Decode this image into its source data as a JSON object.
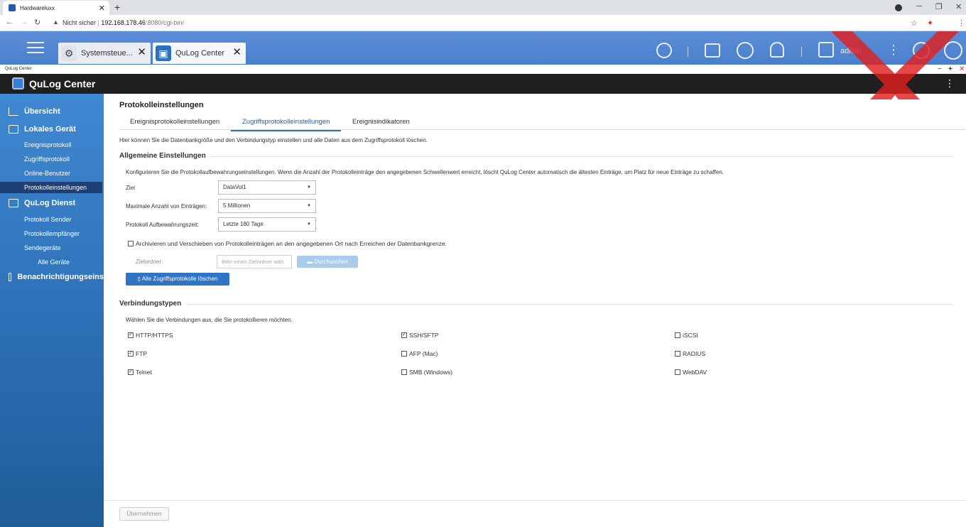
{
  "browser": {
    "tab_title": "Hardwareluxx",
    "tab_close": "✕",
    "new_tab": "+",
    "security": "Nicht sicher",
    "url_host": "192.168.178.46",
    "url_path": ":8080/cgi-bin/",
    "win_min": "─",
    "win_max": "❐",
    "win_close": "✕"
  },
  "qts": {
    "tabs": [
      {
        "label": "Systemsteue..."
      },
      {
        "label": "QuLog Center"
      }
    ],
    "user": "admin"
  },
  "app": {
    "window_label": "QuLog Center",
    "title": "QuLog Center"
  },
  "sidebar": {
    "overview": "Übersicht",
    "local": "Lokales Gerät",
    "local_items": [
      "Ereignisprotokoll",
      "Zugriffsprotokoll",
      "Online-Benutzer",
      "Protokolleinstellungen"
    ],
    "service": "QuLog Dienst",
    "service_items": [
      "Protokoll Sender",
      "Protokollempfänger",
      "Sendegeräte"
    ],
    "all_devices": "Alle Geräte",
    "notify": "Benachrichtigungseins"
  },
  "main": {
    "heading": "Protokolleinstellungen",
    "tabs": [
      "Ereignisprotokolleinstellungen",
      "Zugriffsprotokolleinstellungen",
      "Ereignisindikatoren"
    ],
    "description": "Hier können Sie die Datenbankgröße und den Verbindungstyp einstellen und alle Daten aus dem Zugriffsprotokoll löschen.",
    "general_title": "Allgemeine Einstellungen",
    "general_desc": "Konfigurieren Sie die Protokollaufbewahrungseinstellungen. Wenn die Anzahl der Protokolleinträge den angegebenen Schwellenwert erreicht, löscht QuLog Center automatisch die ältesten Einträge, um Platz für neue Einträge zu schaffen.",
    "fields": [
      {
        "label": "Ziel",
        "value": "DataVol1"
      },
      {
        "label": "Maximale Anzahl von Einträgen:",
        "value": "5 Millionen"
      },
      {
        "label": "Protokoll Aufbewahrungszeit:",
        "value": "Letzte 180 Tage"
      }
    ],
    "archive_label": "Archivieren und Verschieben von Protokolleinträgen an den angegebenen Ort nach Erreichen der Datenbankgrenze.",
    "target_folder_label": "Zielordner:",
    "target_folder_placeholder": "Bitte einen Zielordner wäh",
    "browse_button": "Durchsuchen",
    "delete_button": "Alle Zugriffsprotokolle löschen",
    "conn_title": "Verbindungstypen",
    "conn_desc": "Wählen Sie die Verbindungen aus, die Sie protokollieren möchten.",
    "connections": [
      {
        "label": "HTTP/HTTPS",
        "checked": true
      },
      {
        "label": "SSH/SFTP",
        "checked": true
      },
      {
        "label": "iSCSI",
        "checked": false
      },
      {
        "label": "FTP",
        "checked": true
      },
      {
        "label": "AFP (Mac)",
        "checked": false
      },
      {
        "label": "RADIUS",
        "checked": false
      },
      {
        "label": "Telnet",
        "checked": true
      },
      {
        "label": "SMB (Windows)",
        "checked": false
      },
      {
        "label": "WebDAV",
        "checked": false
      }
    ],
    "apply_button": "Übernehmen"
  }
}
